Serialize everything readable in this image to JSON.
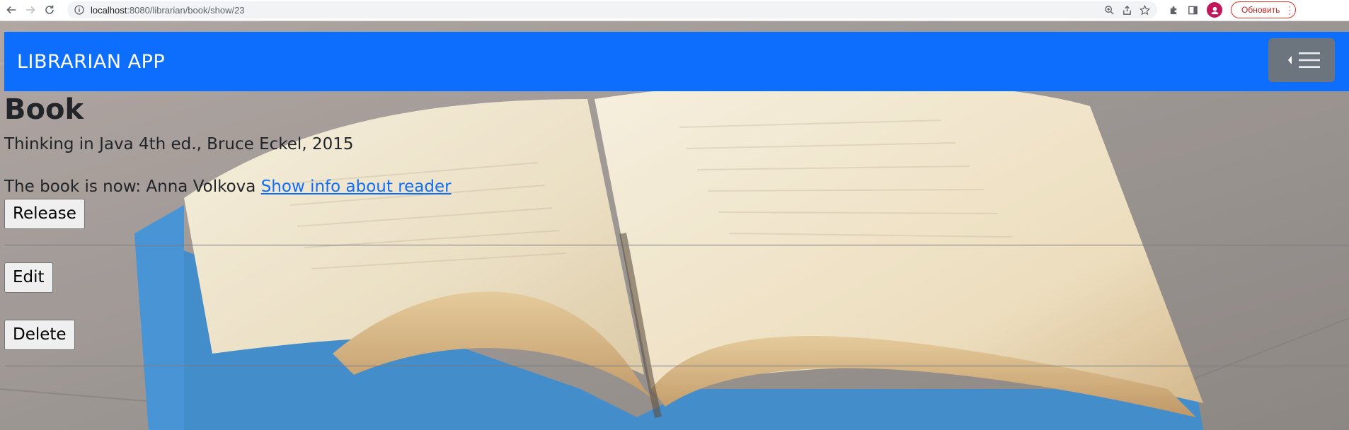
{
  "browser": {
    "url_host": "localhost",
    "url_path": ":8080/librarian/book/show/23",
    "update_label": "Обновить"
  },
  "navbar": {
    "brand": "LIBRARIAN APP"
  },
  "book": {
    "heading": "Book",
    "details": "Thinking in Java 4th ed., Bruce Eckel, 2015",
    "owner_prefix": "The book is now: Anna Volkova",
    "owner_link": "Show info about reader"
  },
  "actions": {
    "release_label": "Release",
    "edit_label": "Edit",
    "delete_label": "Delete"
  },
  "colors": {
    "navbar": "#0d6efd",
    "toggler": "#6c757d",
    "link": "#0d6efd"
  }
}
